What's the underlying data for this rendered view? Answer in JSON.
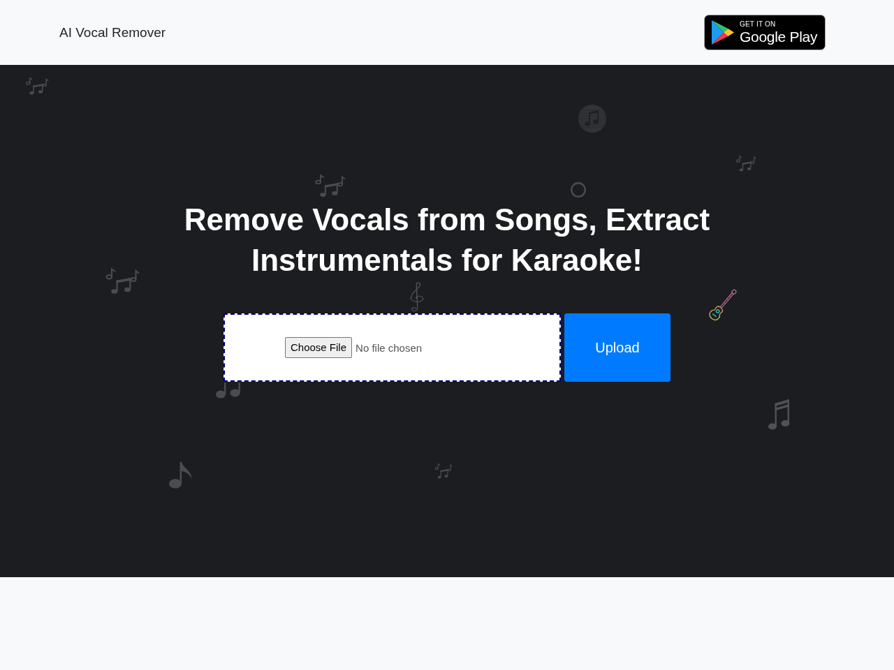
{
  "header": {
    "title": "AI Vocal Remover",
    "store_badge": {
      "caption": "GET IT ON",
      "store": "Google Play"
    }
  },
  "hero": {
    "heading_lines": [
      "Remove Vocals from Songs, Extract",
      "Instrumentals for Karaoke!"
    ],
    "file_picker": {
      "button": "Choose File",
      "status": "No file chosen"
    },
    "upload_button": "Upload"
  }
}
